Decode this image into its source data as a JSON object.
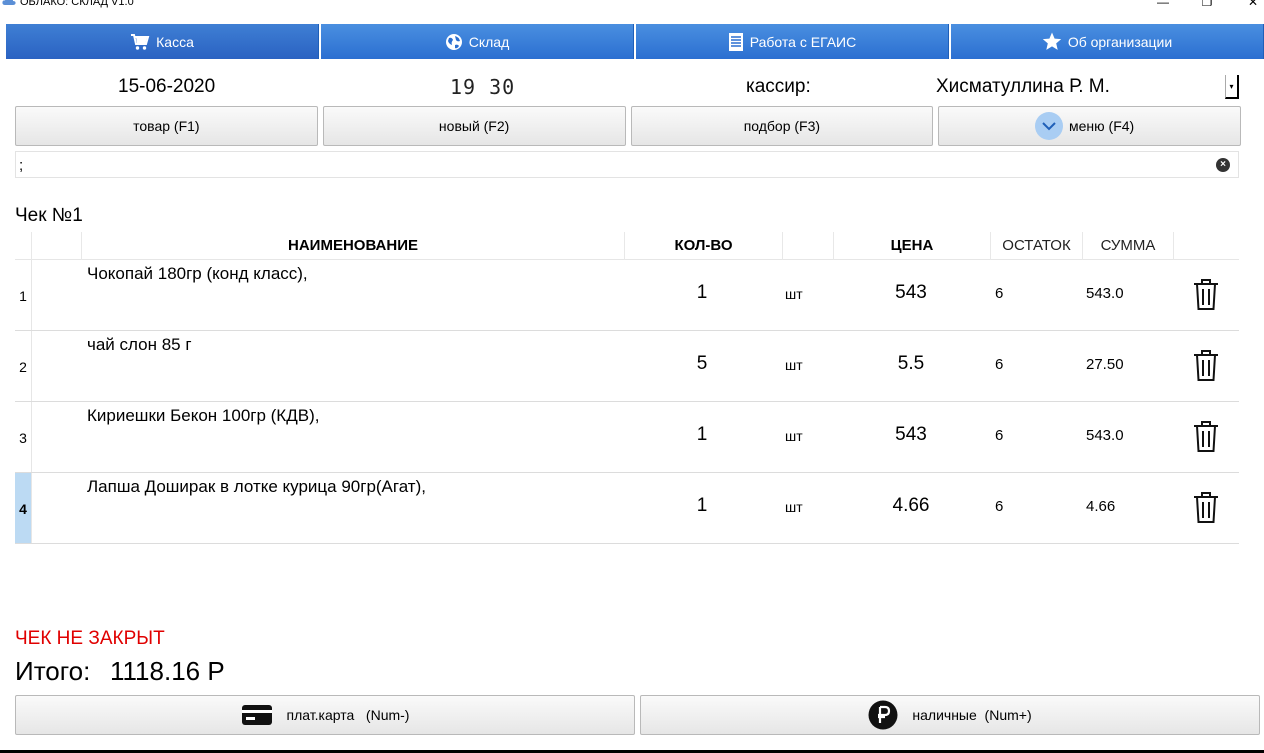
{
  "window": {
    "title": "ОБЛАКО: СКЛАД V1.0",
    "minimize": "—",
    "maximize": "❐",
    "close": "✕"
  },
  "tabs": [
    {
      "label": "Касса",
      "icon": "cart-icon",
      "active": true
    },
    {
      "label": "Склад",
      "icon": "globe-icon",
      "active": false
    },
    {
      "label": "Работа с ЕГАИС",
      "icon": "document-icon",
      "active": false
    },
    {
      "label": "Об организации",
      "icon": "star-icon",
      "active": false
    }
  ],
  "info": {
    "date": "15-06-2020",
    "time": "19 30",
    "cashier_label": "кассир:",
    "cashier_name": "Хисматуллина Р. М."
  },
  "actions": {
    "product": "товар (F1)",
    "new": "новый (F2)",
    "selection": "подбор (F3)",
    "menu": "меню (F4)"
  },
  "search": {
    "value": ";"
  },
  "receipt": {
    "title": "Чек №1",
    "columns": {
      "name": "НАИМЕНОВАНИЕ",
      "qty": "КОЛ-ВО",
      "price": "ЦЕНА",
      "stock": "ОСТАТОК",
      "sum": "СУММА"
    },
    "rows": [
      {
        "num": "1",
        "name": "Чокопай 180гр (конд класс),",
        "qty": "1",
        "unit": "шт",
        "price": "543",
        "stock": "6",
        "sum": "543.0"
      },
      {
        "num": "2",
        "name": "чай слон 85 г",
        "qty": "5",
        "unit": "шт",
        "price": "5.5",
        "stock": "6",
        "sum": "27.50"
      },
      {
        "num": "3",
        "name": "Кириешки Бекон 100гр (КДВ),",
        "qty": "1",
        "unit": "шт",
        "price": "543",
        "stock": "6",
        "sum": "543.0"
      },
      {
        "num": "4",
        "name": "Лапша Доширак в лотке курица 90гр(Агат),",
        "qty": "1",
        "unit": "шт",
        "price": "4.66",
        "stock": "6",
        "sum": "4.66"
      }
    ],
    "selected_row": "4"
  },
  "status": "ЧЕК НЕ ЗАКРЫТ",
  "total": {
    "label": "Итого:",
    "value": "1118.16 Р"
  },
  "payment": {
    "card": "плат.карта   (Num-)",
    "cash": "наличные  (Num+)"
  },
  "colors": {
    "tab_blue": "#2b6fd1",
    "status_red": "#e00000",
    "selected_row": "#bcdaf3"
  }
}
